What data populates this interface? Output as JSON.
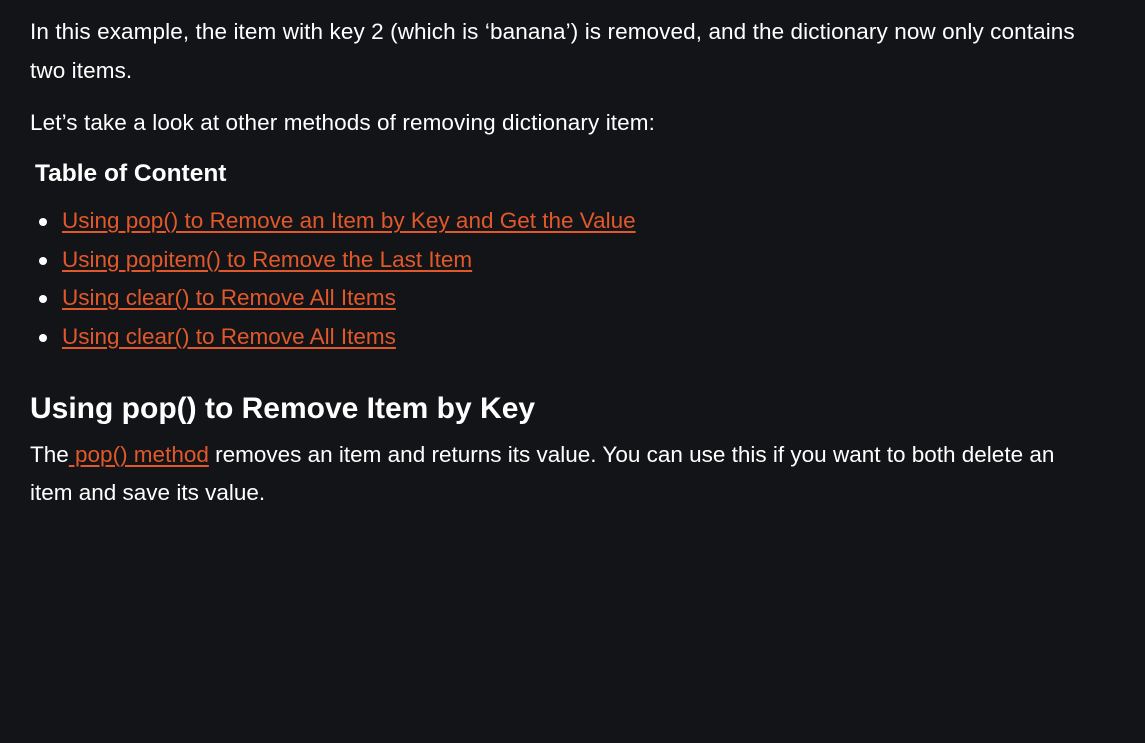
{
  "intro": {
    "paragraph1": "In this example, the item with key 2 (which is ‘banana’) is removed, and the dictionary now only contains two items.",
    "paragraph2": "Let’s take a look at other methods of removing dictionary item:"
  },
  "toc": {
    "title": "Table of Content",
    "items": [
      {
        "label": "Using pop() to Remove an Item by Key and Get the Value"
      },
      {
        "label": "Using popitem() to Remove the Last Item"
      },
      {
        "label": "Using clear() to Remove All Items"
      },
      {
        "label": "Using clear() to Remove All Items"
      }
    ]
  },
  "section": {
    "heading": "Using pop() to Remove Item by Key",
    "text_before_link": "The",
    "link_text": " pop() method",
    "text_after_link": " removes an item and returns its value. You can use this if you want to both delete an item and save its value."
  },
  "colors": {
    "background": "#131417",
    "text": "#ffffff",
    "link": "#e1582b"
  }
}
